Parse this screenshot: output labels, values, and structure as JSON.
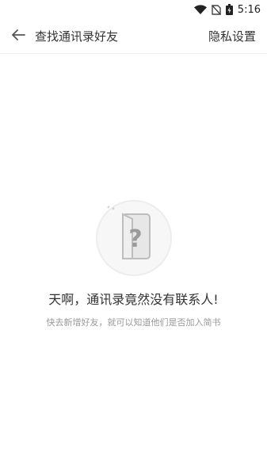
{
  "status_bar": {
    "time": "5:16",
    "icons": [
      "wifi-icon",
      "no-sim-icon",
      "battery-charging-icon"
    ]
  },
  "header": {
    "title": "查找通讯录好友",
    "action_label": "隐私设置",
    "back_icon": "back-arrow-icon"
  },
  "empty_state": {
    "illustration": "contact-book-question-icon",
    "title": "天啊，通讯录竟然没有联系人!",
    "subtitle": "快去新增好友，就可以知道他们是否加入简书"
  },
  "colors": {
    "text_primary": "#333333",
    "text_secondary": "#999999",
    "illustration_gray": "#d9d9d9"
  }
}
